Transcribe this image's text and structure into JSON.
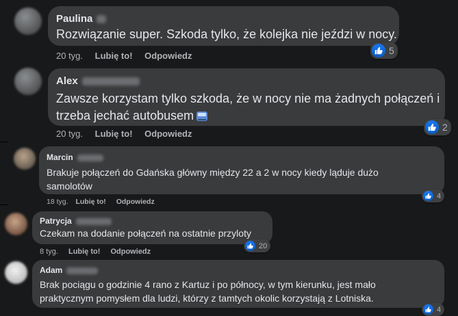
{
  "comments": [
    {
      "author": "Paulina",
      "text": "Rozwiązanie super. Szkoda tylko, że kolejka nie jeździ w nocy.",
      "time": "20 tyg.",
      "like_label": "Lubię to!",
      "reply_label": "Odpowiedz",
      "reaction_count": "5"
    },
    {
      "author": "Alex",
      "text_line1": "Zawsze korzystam tylko szkoda, że w nocy nie ma żadnych połączeń i",
      "text_line2": "trzeba jechać autobusem",
      "emoji": "bus-icon",
      "time": "20 tyg.",
      "like_label": "Lubię to!",
      "reply_label": "Odpowiedz",
      "reaction_count": "2"
    },
    {
      "author": "Marcin",
      "text_line1": "Brakuje połączeń do Gdańska główny między 22 a 2 w nocy kiedy ląduje dużo",
      "text_line2": "samolotów",
      "time": "18 tyg.",
      "like_label": "Lubię to!",
      "reply_label": "Odpowiedz",
      "reaction_count": "4"
    },
    {
      "author": "Patrycja",
      "text": "Czekam na dodanie połączeń na ostatnie przyloty",
      "time": "8 tyg.",
      "like_label": "Lubię to!",
      "reply_label": "Odpowiedz",
      "reaction_count": "20"
    },
    {
      "author": "Adam",
      "text_line1": "Brak pociągu o godzinie 4 rano z Kartuz i po północy, w tym kierunku, jest mało",
      "text_line2": "praktycznym pomysłem dla ludzi, którzy z tamtych okolic korzystają z Lotniska.",
      "reaction_count": "4"
    }
  ],
  "colors": {
    "background": "#18191a",
    "bubble": "#3a3b3c",
    "text": "#e4e6eb",
    "secondary_text": "#b0b3b8",
    "like_blue": "#1877f2"
  }
}
